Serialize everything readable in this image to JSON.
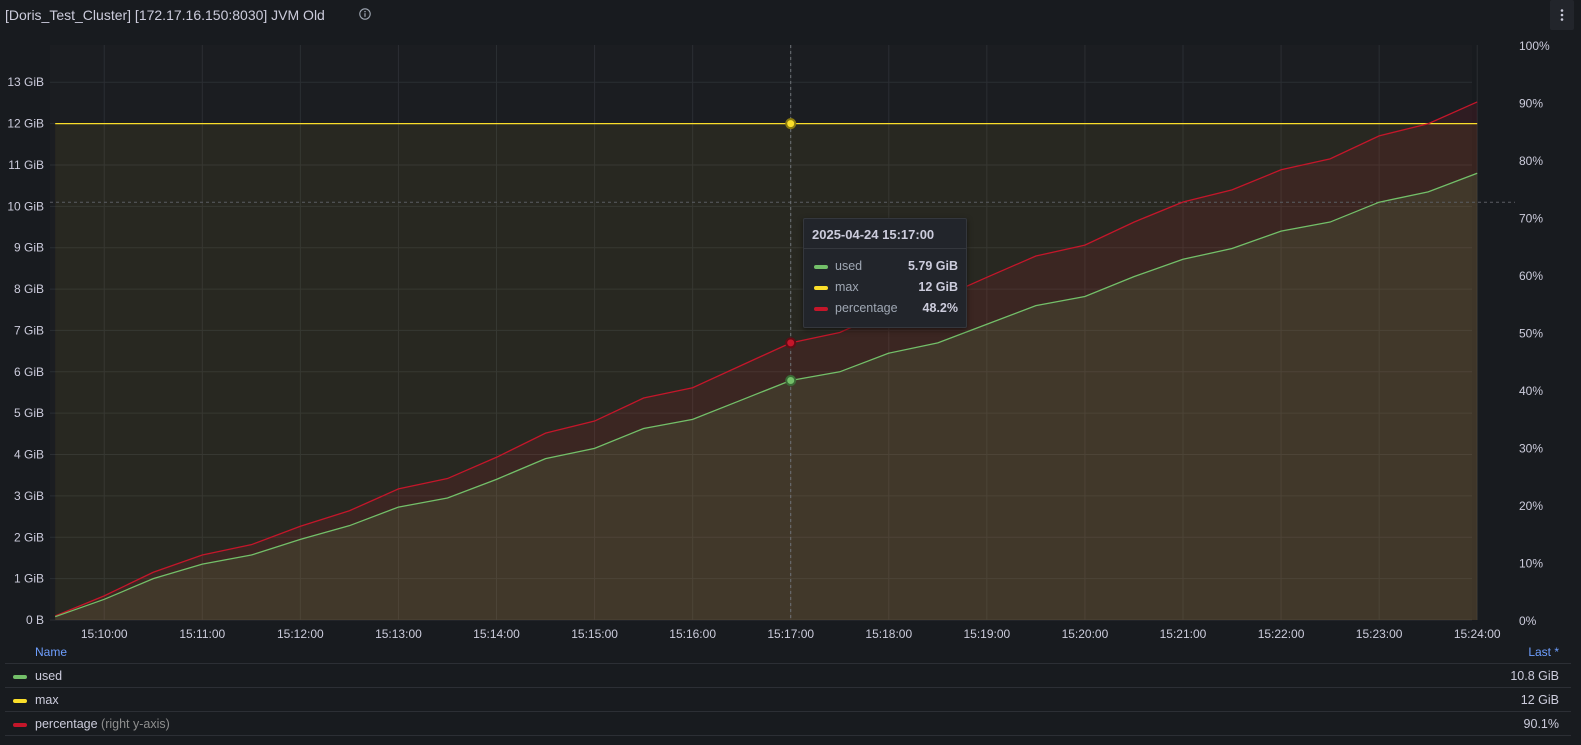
{
  "panel": {
    "title": "[Doris_Test_Cluster] [172.17.16.150:8030] JVM Old",
    "info_icon": "info-circle-icon",
    "menu_icon": "kebab-menu-icon"
  },
  "tooltip": {
    "time": "2025-04-24 15:17:00",
    "rows": [
      {
        "name": "used",
        "value": "5.79 GiB",
        "color": "#73bf69"
      },
      {
        "name": "max",
        "value": "12 GiB",
        "color": "#fade2a"
      },
      {
        "name": "percentage",
        "value": "48.2%",
        "color": "#c4162a"
      }
    ]
  },
  "legend": {
    "name_header": "Name",
    "last_header": "Last *",
    "rows": [
      {
        "name": "used",
        "note": "",
        "last": "10.8 GiB",
        "color": "#73bf69"
      },
      {
        "name": "max",
        "note": "",
        "last": "12 GiB",
        "color": "#fade2a"
      },
      {
        "name": "percentage",
        "note": "(right y-axis)",
        "last": "90.1%",
        "color": "#c4162a"
      }
    ]
  },
  "chart_data": {
    "type": "line",
    "title": "[Doris_Test_Cluster] [172.17.16.150:8030] JVM Old",
    "x_start": "15:09:30",
    "x_step_seconds": 30,
    "x_ticks": [
      "15:10:00",
      "15:11:00",
      "15:12:00",
      "15:13:00",
      "15:14:00",
      "15:15:00",
      "15:16:00",
      "15:17:00",
      "15:18:00",
      "15:19:00",
      "15:20:00",
      "15:21:00",
      "15:22:00",
      "15:23:00",
      "15:24:00"
    ],
    "y_left": {
      "min": 0,
      "max": 13.9,
      "ticks": [
        "0 B",
        "1 GiB",
        "2 GiB",
        "3 GiB",
        "4 GiB",
        "5 GiB",
        "6 GiB",
        "7 GiB",
        "8 GiB",
        "9 GiB",
        "10 GiB",
        "11 GiB",
        "12 GiB",
        "13 GiB"
      ]
    },
    "y_right": {
      "min": 0,
      "max": 100,
      "ticks": [
        "0%",
        "10%",
        "20%",
        "30%",
        "40%",
        "50%",
        "60%",
        "70%",
        "80%",
        "90%",
        "100%"
      ]
    },
    "hover_time": "15:17:00",
    "threshold_dashed_gib": 10.1,
    "grid": true,
    "legend_position": "bottom",
    "series": [
      {
        "name": "used",
        "axis": "left",
        "unit": "GiB",
        "color": "#73bf69",
        "values": [
          0.08,
          0.5,
          1.0,
          1.35,
          1.57,
          1.95,
          2.28,
          2.73,
          2.95,
          3.4,
          3.9,
          4.15,
          4.63,
          4.85,
          5.32,
          5.79,
          6.0,
          6.45,
          6.7,
          7.15,
          7.6,
          7.82,
          8.3,
          8.72,
          8.98,
          9.4,
          9.62,
          10.1,
          10.35,
          10.8
        ]
      },
      {
        "name": "max",
        "axis": "left",
        "unit": "GiB",
        "color": "#fade2a",
        "values": [
          12,
          12,
          12,
          12,
          12,
          12,
          12,
          12,
          12,
          12,
          12,
          12,
          12,
          12,
          12,
          12,
          12,
          12,
          12,
          12,
          12,
          12,
          12,
          12,
          12,
          12,
          12,
          12,
          12,
          12
        ]
      },
      {
        "name": "percentage",
        "axis": "right",
        "unit": "%",
        "color": "#c4162a",
        "values": [
          0.7,
          4.2,
          8.3,
          11.3,
          13.1,
          16.3,
          19.0,
          22.8,
          24.6,
          28.3,
          32.5,
          34.6,
          38.6,
          40.4,
          44.3,
          48.2,
          50.0,
          53.8,
          55.8,
          59.6,
          63.3,
          65.2,
          69.2,
          72.7,
          74.8,
          78.3,
          80.2,
          84.2,
          86.3,
          90.1
        ]
      }
    ]
  }
}
